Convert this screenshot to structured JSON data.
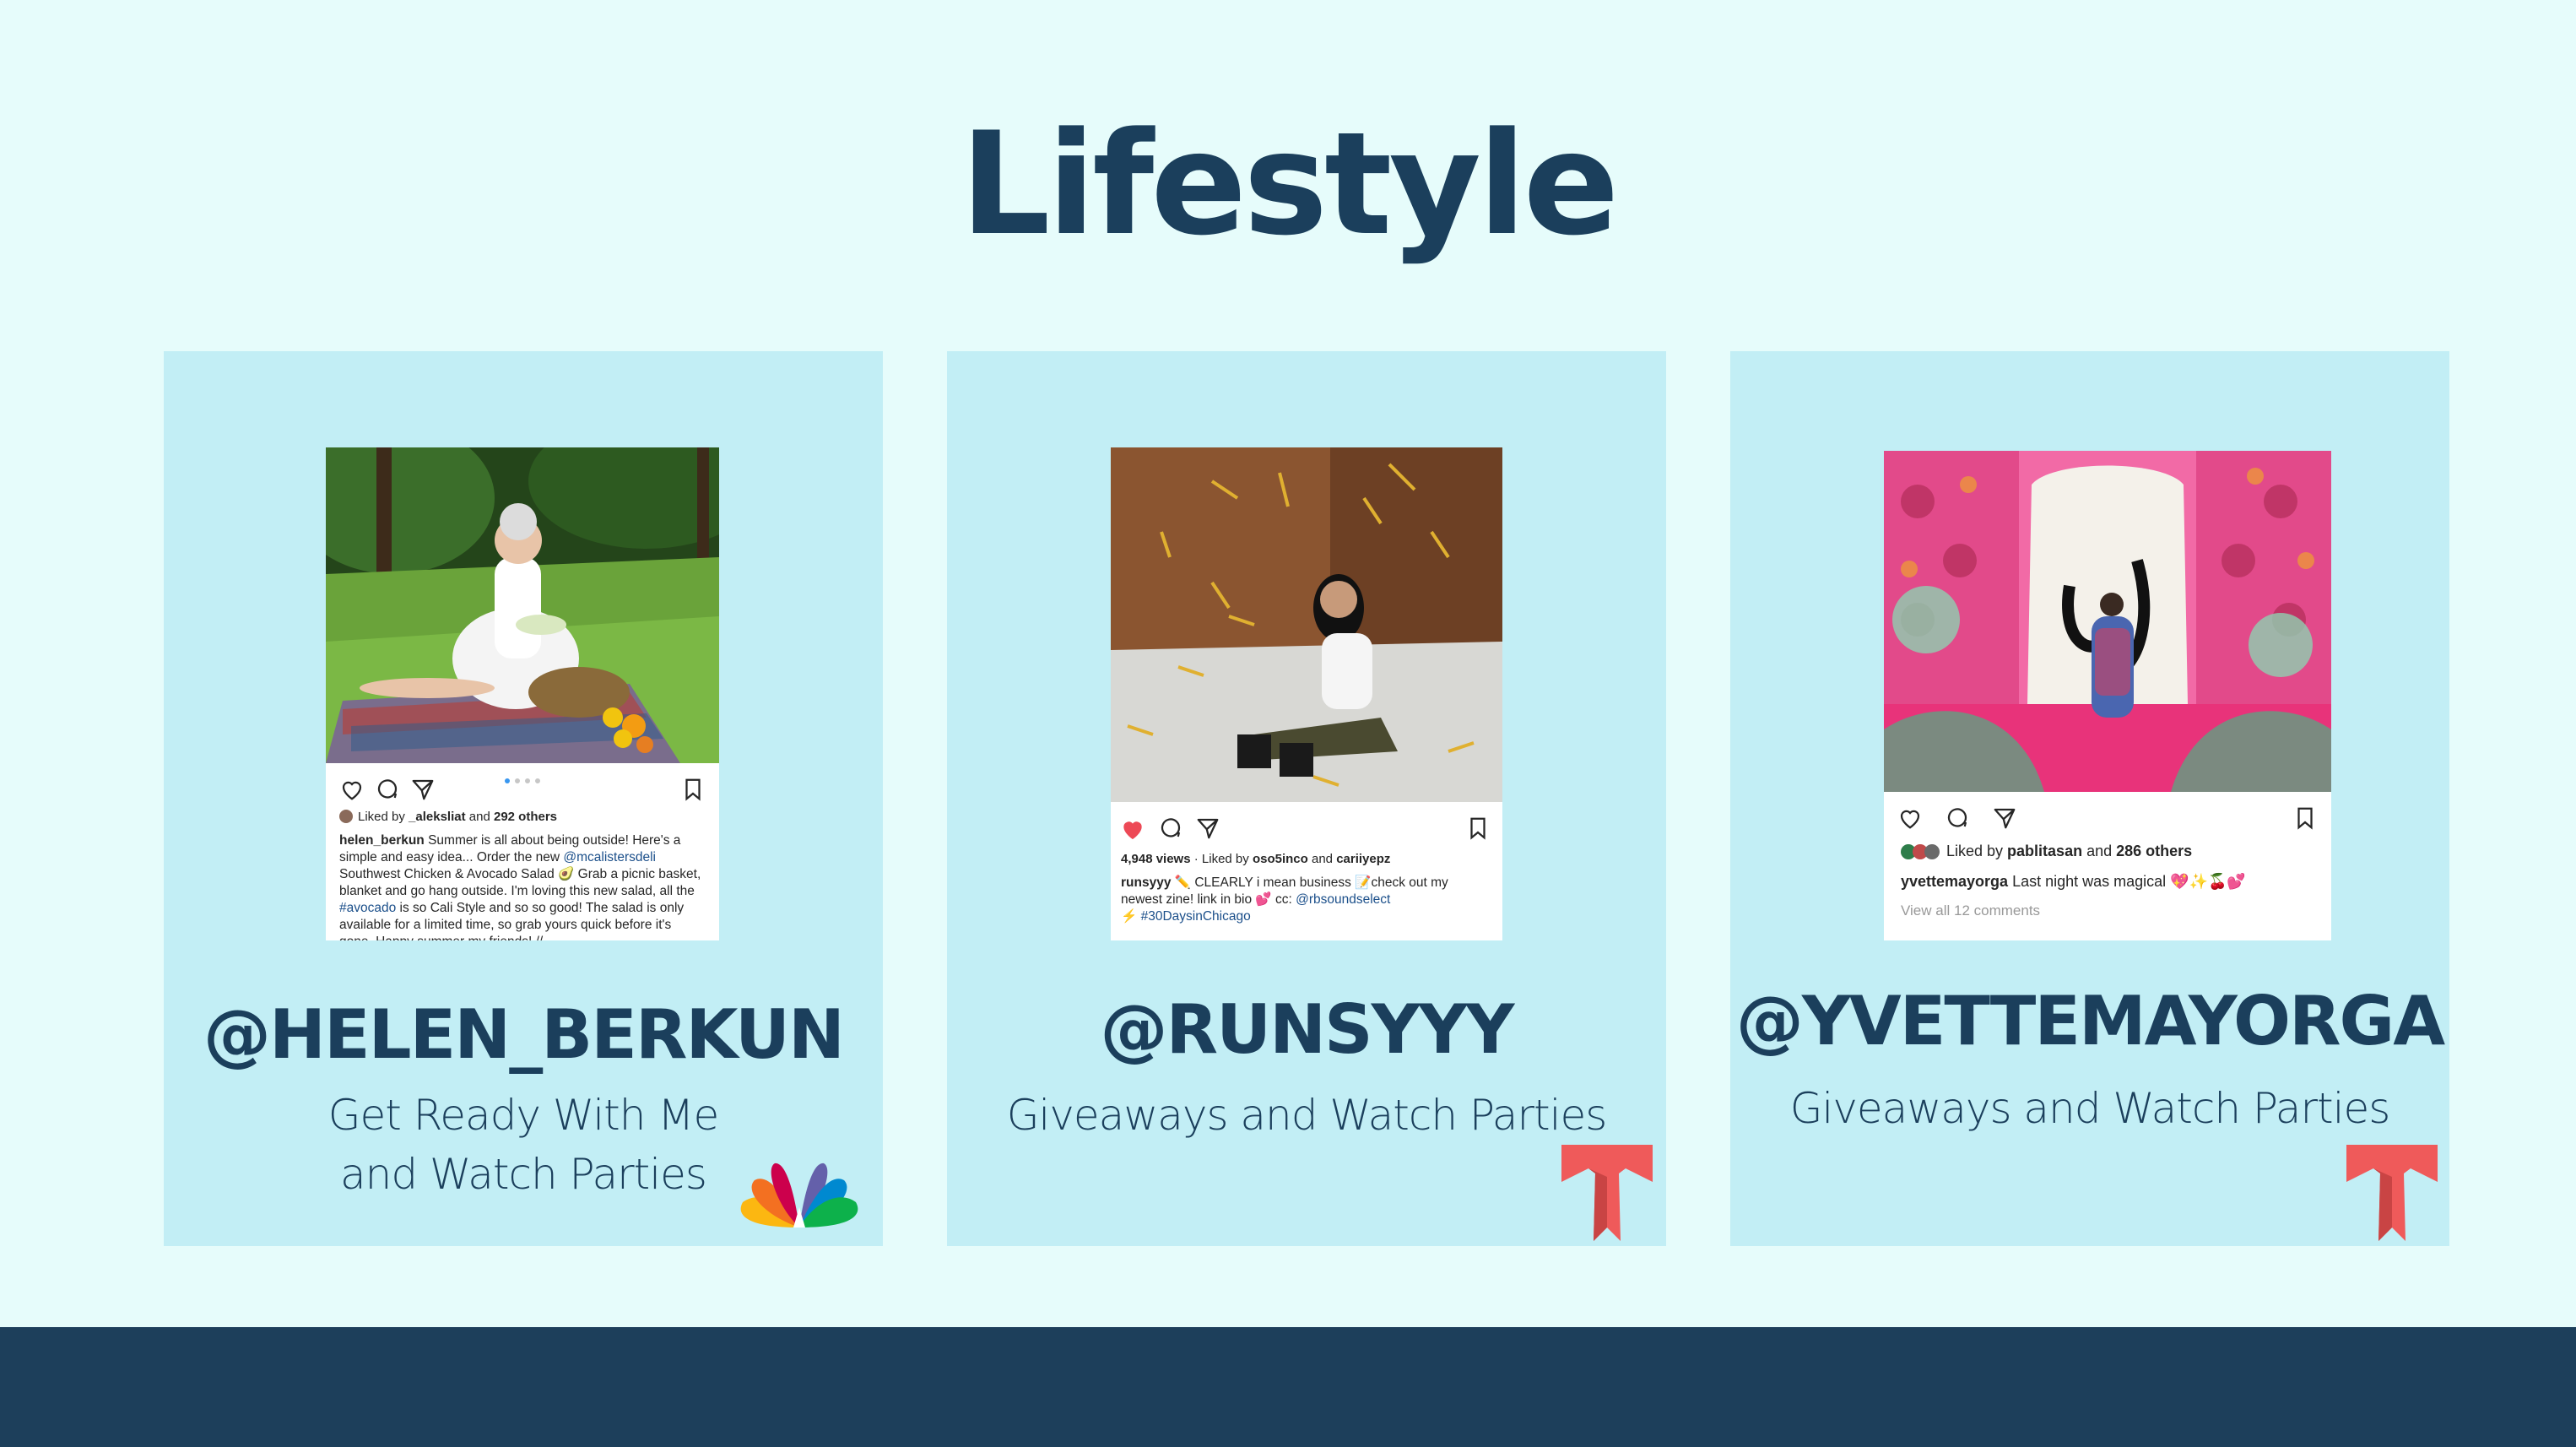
{
  "title": "Lifestyle",
  "colors": {
    "background": "#e6fcfb",
    "card": "#c2eef5",
    "text": "#1b3f5c",
    "footer": "#1d3f5b",
    "telemundo_red": "#ef5a5a"
  },
  "cards": [
    {
      "handle": "@HELEN_BERKUN",
      "description": "Get Ready With Me and Watch Parties",
      "logo": "nbc-peacock-icon",
      "post": {
        "liked_by_prefix": "Liked by ",
        "liked_by_user": "_aleksliat",
        "liked_by_mid": " and ",
        "liked_by_count": "292 others",
        "caption_user": "helen_berkun",
        "caption_1": " Summer is all about being outside! Here's a simple and easy idea... Order the new ",
        "caption_mention": "@mcalistersdeli",
        "caption_2": " Southwest Chicken & Avocado Salad 🥑 Grab a picnic basket, blanket and go hang outside. I'm loving this new salad, all the ",
        "caption_tag": "#avocado",
        "caption_3": " is so Cali Style and so so good! The salad is only available for a limited time, so grab yours quick before it's gone. Happy summer my friends! //"
      }
    },
    {
      "handle": "@RUNSYYY",
      "description": "Giveaways and Watch Parties",
      "logo": "telemundo-t-icon",
      "post": {
        "views": "4,948 views",
        "liked_by_prefix": " · Liked by ",
        "liked_by_user": "oso5inco",
        "liked_by_mid": " and ",
        "liked_by_user2": "cariiyepz",
        "caption_user": "runsyyy",
        "caption_1": " ✏️ CLEARLY i mean business 📝check out my newest zine! link in bio 💕 cc: ",
        "caption_mention": "@rbsoundselect",
        "caption_tag": "⚡ #30DaysinChicago"
      }
    },
    {
      "handle": "@YVETTEMAYORGA",
      "description": "Giveaways and Watch Parties",
      "logo": "telemundo-t-icon",
      "post": {
        "liked_by_prefix": "Liked by ",
        "liked_by_user": "pablitasan",
        "liked_by_mid": " and ",
        "liked_by_count": "286 others",
        "caption_user": "yvettemayorga",
        "caption_1": " Last night was magical 💖✨🍒💕",
        "view_comments": "View all 12 comments"
      }
    }
  ]
}
